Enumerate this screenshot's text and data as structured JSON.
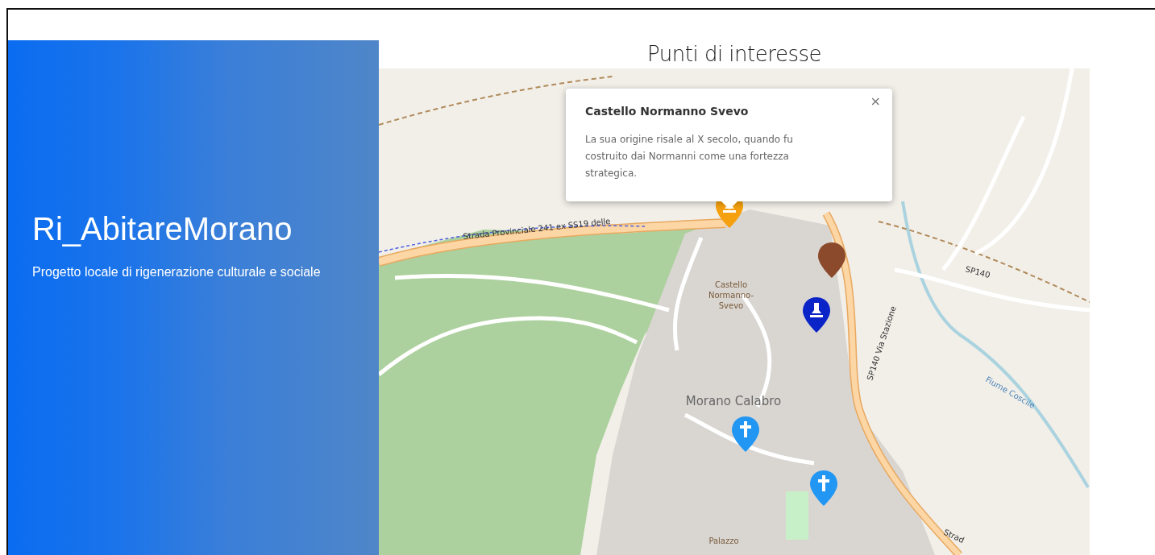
{
  "hero": {
    "title": "Ri_AbitareMorano",
    "subtitle": "Progetto locale di rigenerazione culturale e sociale"
  },
  "map_section": {
    "title": "Punti di interesse",
    "popup": {
      "title": "Castello Normanno Svevo",
      "text": "La sua origine risale al X secolo, quando fu costruito dai Normanni come una fortezza strategica.",
      "close": "×"
    },
    "labels": [
      {
        "kind": "road",
        "lines": [
          "Strada Provinciale 241 ex SS19 delle"
        ]
      },
      {
        "kind": "poi",
        "lines": [
          "Castello",
          "Normanno-",
          "Svevo"
        ]
      },
      {
        "kind": "place",
        "lines": [
          "Morano Calabro"
        ]
      },
      {
        "kind": "road",
        "lines": [
          "SP140"
        ]
      },
      {
        "kind": "road",
        "lines": [
          "SP140 Via Stazione"
        ]
      },
      {
        "kind": "water",
        "lines": [
          "Fiume Coscile"
        ]
      },
      {
        "kind": "poi",
        "lines": [
          "Palazzo"
        ]
      },
      {
        "kind": "road",
        "lines": [
          "Strad"
        ]
      }
    ],
    "markers": [
      {
        "kind": "monument",
        "color": "#f5a00e"
      },
      {
        "kind": "other",
        "color": "#8b4a2b"
      },
      {
        "kind": "monument",
        "color": "#0a24c8"
      },
      {
        "kind": "church",
        "color": "#2196f3"
      },
      {
        "kind": "church",
        "color": "#2196f3"
      }
    ]
  }
}
